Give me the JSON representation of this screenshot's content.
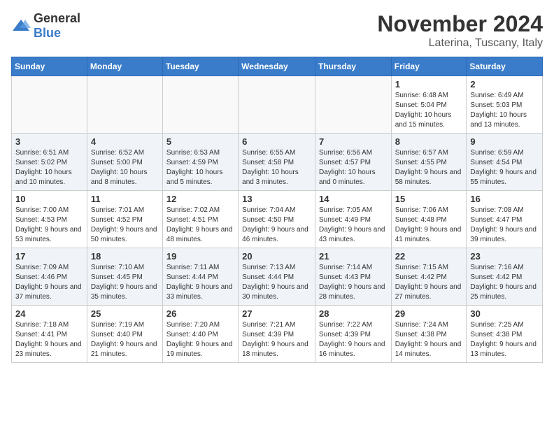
{
  "header": {
    "logo_general": "General",
    "logo_blue": "Blue",
    "month": "November 2024",
    "location": "Laterina, Tuscany, Italy"
  },
  "weekdays": [
    "Sunday",
    "Monday",
    "Tuesday",
    "Wednesday",
    "Thursday",
    "Friday",
    "Saturday"
  ],
  "weeks": [
    [
      {
        "day": "",
        "text": ""
      },
      {
        "day": "",
        "text": ""
      },
      {
        "day": "",
        "text": ""
      },
      {
        "day": "",
        "text": ""
      },
      {
        "day": "",
        "text": ""
      },
      {
        "day": "1",
        "text": "Sunrise: 6:48 AM\nSunset: 5:04 PM\nDaylight: 10 hours and 15 minutes."
      },
      {
        "day": "2",
        "text": "Sunrise: 6:49 AM\nSunset: 5:03 PM\nDaylight: 10 hours and 13 minutes."
      }
    ],
    [
      {
        "day": "3",
        "text": "Sunrise: 6:51 AM\nSunset: 5:02 PM\nDaylight: 10 hours and 10 minutes."
      },
      {
        "day": "4",
        "text": "Sunrise: 6:52 AM\nSunset: 5:00 PM\nDaylight: 10 hours and 8 minutes."
      },
      {
        "day": "5",
        "text": "Sunrise: 6:53 AM\nSunset: 4:59 PM\nDaylight: 10 hours and 5 minutes."
      },
      {
        "day": "6",
        "text": "Sunrise: 6:55 AM\nSunset: 4:58 PM\nDaylight: 10 hours and 3 minutes."
      },
      {
        "day": "7",
        "text": "Sunrise: 6:56 AM\nSunset: 4:57 PM\nDaylight: 10 hours and 0 minutes."
      },
      {
        "day": "8",
        "text": "Sunrise: 6:57 AM\nSunset: 4:55 PM\nDaylight: 9 hours and 58 minutes."
      },
      {
        "day": "9",
        "text": "Sunrise: 6:59 AM\nSunset: 4:54 PM\nDaylight: 9 hours and 55 minutes."
      }
    ],
    [
      {
        "day": "10",
        "text": "Sunrise: 7:00 AM\nSunset: 4:53 PM\nDaylight: 9 hours and 53 minutes."
      },
      {
        "day": "11",
        "text": "Sunrise: 7:01 AM\nSunset: 4:52 PM\nDaylight: 9 hours and 50 minutes."
      },
      {
        "day": "12",
        "text": "Sunrise: 7:02 AM\nSunset: 4:51 PM\nDaylight: 9 hours and 48 minutes."
      },
      {
        "day": "13",
        "text": "Sunrise: 7:04 AM\nSunset: 4:50 PM\nDaylight: 9 hours and 46 minutes."
      },
      {
        "day": "14",
        "text": "Sunrise: 7:05 AM\nSunset: 4:49 PM\nDaylight: 9 hours and 43 minutes."
      },
      {
        "day": "15",
        "text": "Sunrise: 7:06 AM\nSunset: 4:48 PM\nDaylight: 9 hours and 41 minutes."
      },
      {
        "day": "16",
        "text": "Sunrise: 7:08 AM\nSunset: 4:47 PM\nDaylight: 9 hours and 39 minutes."
      }
    ],
    [
      {
        "day": "17",
        "text": "Sunrise: 7:09 AM\nSunset: 4:46 PM\nDaylight: 9 hours and 37 minutes."
      },
      {
        "day": "18",
        "text": "Sunrise: 7:10 AM\nSunset: 4:45 PM\nDaylight: 9 hours and 35 minutes."
      },
      {
        "day": "19",
        "text": "Sunrise: 7:11 AM\nSunset: 4:44 PM\nDaylight: 9 hours and 33 minutes."
      },
      {
        "day": "20",
        "text": "Sunrise: 7:13 AM\nSunset: 4:44 PM\nDaylight: 9 hours and 30 minutes."
      },
      {
        "day": "21",
        "text": "Sunrise: 7:14 AM\nSunset: 4:43 PM\nDaylight: 9 hours and 28 minutes."
      },
      {
        "day": "22",
        "text": "Sunrise: 7:15 AM\nSunset: 4:42 PM\nDaylight: 9 hours and 27 minutes."
      },
      {
        "day": "23",
        "text": "Sunrise: 7:16 AM\nSunset: 4:42 PM\nDaylight: 9 hours and 25 minutes."
      }
    ],
    [
      {
        "day": "24",
        "text": "Sunrise: 7:18 AM\nSunset: 4:41 PM\nDaylight: 9 hours and 23 minutes."
      },
      {
        "day": "25",
        "text": "Sunrise: 7:19 AM\nSunset: 4:40 PM\nDaylight: 9 hours and 21 minutes."
      },
      {
        "day": "26",
        "text": "Sunrise: 7:20 AM\nSunset: 4:40 PM\nDaylight: 9 hours and 19 minutes."
      },
      {
        "day": "27",
        "text": "Sunrise: 7:21 AM\nSunset: 4:39 PM\nDaylight: 9 hours and 18 minutes."
      },
      {
        "day": "28",
        "text": "Sunrise: 7:22 AM\nSunset: 4:39 PM\nDaylight: 9 hours and 16 minutes."
      },
      {
        "day": "29",
        "text": "Sunrise: 7:24 AM\nSunset: 4:38 PM\nDaylight: 9 hours and 14 minutes."
      },
      {
        "day": "30",
        "text": "Sunrise: 7:25 AM\nSunset: 4:38 PM\nDaylight: 9 hours and 13 minutes."
      }
    ]
  ]
}
